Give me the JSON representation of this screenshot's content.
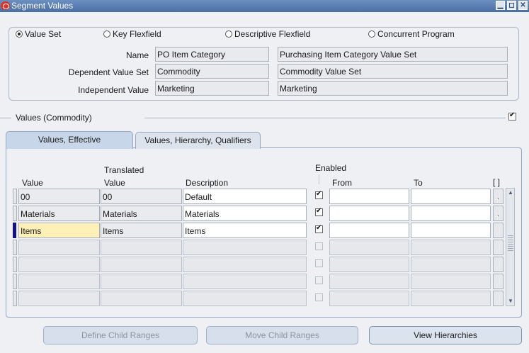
{
  "window": {
    "title": "Segment Values",
    "minimize": "▁",
    "restore": "◻",
    "close": "✕"
  },
  "radios": [
    {
      "label": "Value Set",
      "selected": true
    },
    {
      "label": "Key Flexfield",
      "selected": false
    },
    {
      "label": "Descriptive Flexfield",
      "selected": false
    },
    {
      "label": "Concurrent Program",
      "selected": false
    }
  ],
  "form": {
    "name_label": "Name",
    "name_value": "PO Item Category",
    "name_desc": "Purchasing Item Category Value Set",
    "dependent_label": "Dependent Value Set",
    "dependent_value": "Commodity",
    "dependent_desc": "Commodity Value Set",
    "independent_label": "Independent Value",
    "independent_value": "Marketing",
    "independent_desc": "Marketing"
  },
  "values_section": {
    "title": "Values (Commodity)",
    "checked": true
  },
  "tabs": [
    {
      "label": "Values, Effective",
      "active": true
    },
    {
      "label": "Values, Hierarchy, Qualifiers",
      "active": false
    }
  ],
  "columns": {
    "value": "Value",
    "translated_1": "Translated",
    "translated_2": "Value",
    "description": "Description",
    "enabled": "Enabled",
    "from": "From",
    "to": "To",
    "bracket": "[ ]"
  },
  "rows": [
    {
      "value": "00",
      "translated": "00",
      "description": "Default",
      "enabled": true,
      "from": "",
      "to": "",
      "mini": "."
    },
    {
      "value": "Materials",
      "translated": "Materials",
      "description": "Materials",
      "enabled": true,
      "from": "",
      "to": "",
      "mini": "."
    },
    {
      "value": "Items",
      "translated": "Items",
      "description": "Items",
      "enabled": true,
      "from": "",
      "to": "",
      "mini": ""
    }
  ],
  "buttons": {
    "define_child": "Define Child Ranges",
    "move_child": "Move Child Ranges",
    "view_hierarchies": "View Hierarchies"
  },
  "colors": {
    "titlebar": "#4a6fa5",
    "current_row": "#12148a",
    "current_cell": "#fff0b8"
  }
}
